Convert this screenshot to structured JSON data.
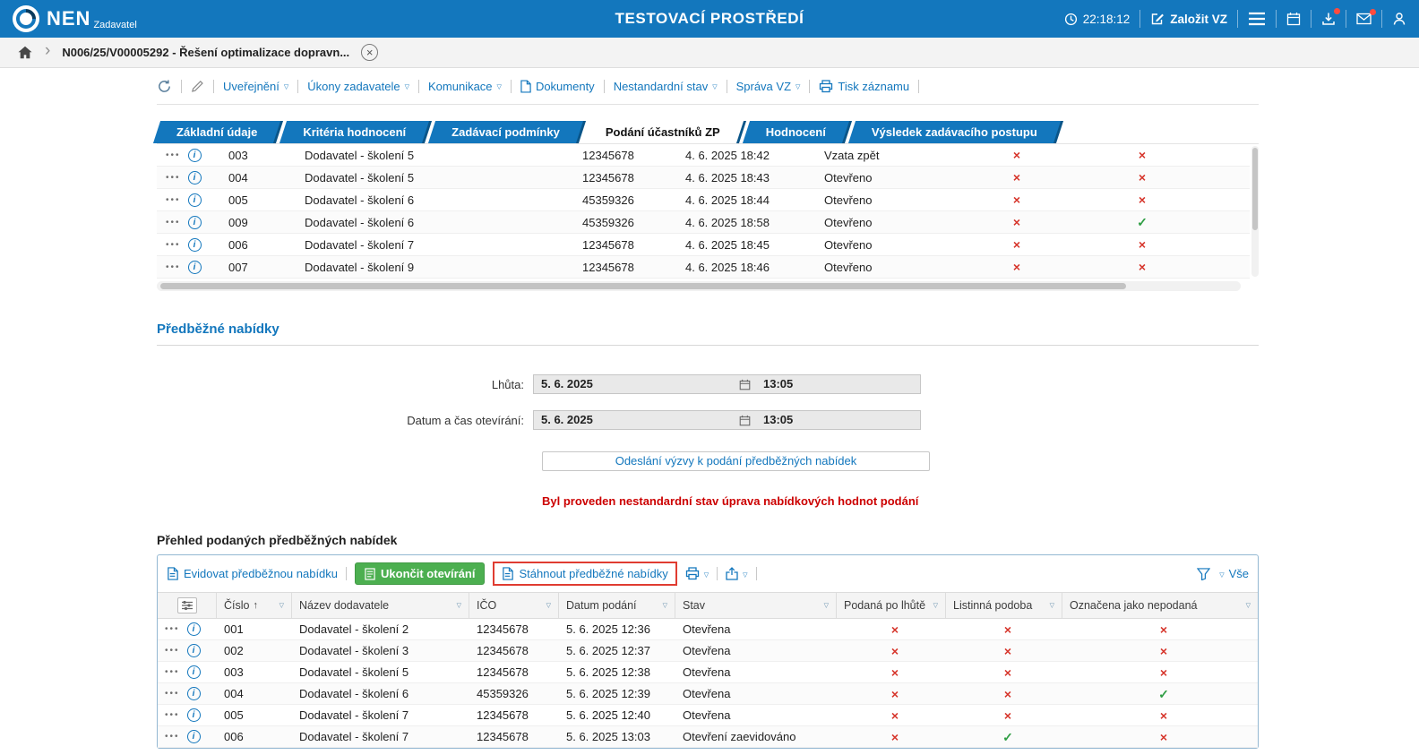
{
  "colors": {
    "topbar_blue": "#1377bd",
    "accent_blue": "#1377bd",
    "green_button": "#4caf50",
    "warning_red": "#cc0000",
    "mark_red": "#d6342a",
    "mark_green": "#2f9e44",
    "highlight_red": "#e03c31"
  },
  "icons": {
    "caret": "▽",
    "sort_asc": "↑",
    "dots_menu": "•••",
    "chevron": "›",
    "info": "i",
    "close": "×",
    "check": "✓",
    "cross": "×"
  },
  "topbar": {
    "brand": "NEN",
    "brand_sub": "Zadavatel",
    "env_title": "TESTOVACÍ PROSTŘEDÍ",
    "time": "22:18:12",
    "create_vz": "Založit VZ"
  },
  "breadcrumb": {
    "record": "N006/25/V00005292 - Řešení optimalizace dopravn..."
  },
  "toolbar": {
    "items": [
      {
        "label": "Uveřejnění"
      },
      {
        "label": "Úkony zadavatele"
      },
      {
        "label": "Komunikace"
      },
      {
        "label": "Dokumenty"
      },
      {
        "label": "Nestandardní stav"
      },
      {
        "label": "Správa VZ"
      },
      {
        "label": "Tisk záznamu"
      }
    ]
  },
  "tabs": [
    {
      "label": "Základní údaje",
      "active": false
    },
    {
      "label": "Kritéria hodnocení",
      "active": false
    },
    {
      "label": "Zadávací podmínky",
      "active": false
    },
    {
      "label": "Podání účastníků ZP",
      "active": true
    },
    {
      "label": "Hodnocení",
      "active": false
    },
    {
      "label": "Výsledek zadávacího postupu",
      "active": false
    }
  ],
  "participants_table": {
    "rows": [
      {
        "cislo": "003",
        "nazev": "Dodavatel - školení 5",
        "ico": "12345678",
        "datum": "4. 6. 2025 18:42",
        "stav": "Vzata zpět",
        "f1": false,
        "f2": false
      },
      {
        "cislo": "004",
        "nazev": "Dodavatel - školení 5",
        "ico": "12345678",
        "datum": "4. 6. 2025 18:43",
        "stav": "Otevřeno",
        "f1": false,
        "f2": false
      },
      {
        "cislo": "005",
        "nazev": "Dodavatel - školení 6",
        "ico": "45359326",
        "datum": "4. 6. 2025 18:44",
        "stav": "Otevřeno",
        "f1": false,
        "f2": false
      },
      {
        "cislo": "009",
        "nazev": "Dodavatel - školení 6",
        "ico": "45359326",
        "datum": "4. 6. 2025 18:58",
        "stav": "Otevřeno",
        "f1": false,
        "f2": true
      },
      {
        "cislo": "006",
        "nazev": "Dodavatel - školení 7",
        "ico": "12345678",
        "datum": "4. 6. 2025 18:45",
        "stav": "Otevřeno",
        "f1": false,
        "f2": false
      },
      {
        "cislo": "007",
        "nazev": "Dodavatel - školení 9",
        "ico": "12345678",
        "datum": "4. 6. 2025 18:46",
        "stav": "Otevřeno",
        "f1": false,
        "f2": false
      }
    ]
  },
  "section": {
    "title": "Předběžné nabídky",
    "lhuta_label": "Lhůta:",
    "lhuta_date": "5. 6. 2025",
    "lhuta_time": "13:05",
    "oteviranie_label": "Datum a čas otevírání:",
    "oteviranie_date": "5. 6. 2025",
    "oteviranie_time": "13:05",
    "send_button": "Odeslání výzvy k podání předběžných nabídek",
    "warning": "Byl proveden nestandardní stav úprava nabídkových hodnot podání",
    "overview_title": "Přehled podaných předběžných nabídek"
  },
  "offers_panel": {
    "toolbar": {
      "evidovat": "Evidovat předběžnou nabídku",
      "ukoncit": "Ukončit otevírání",
      "stahnout": "Stáhnout předběžné nabídky",
      "vse": "Vše"
    },
    "headers": [
      "Číslo",
      "Název dodavatele",
      "IČO",
      "Datum podání",
      "Stav",
      "Podaná po lhůtě",
      "Listinná podoba",
      "Označena jako nepodaná"
    ],
    "rows": [
      {
        "cislo": "001",
        "nazev": "Dodavatel - školení 2",
        "ico": "12345678",
        "datum": "5. 6. 2025 12:36",
        "stav": "Otevřena",
        "po_lhute": false,
        "listinna": false,
        "nepodana": false
      },
      {
        "cislo": "002",
        "nazev": "Dodavatel - školení 3",
        "ico": "12345678",
        "datum": "5. 6. 2025 12:37",
        "stav": "Otevřena",
        "po_lhute": false,
        "listinna": false,
        "nepodana": false
      },
      {
        "cislo": "003",
        "nazev": "Dodavatel - školení 5",
        "ico": "12345678",
        "datum": "5. 6. 2025 12:38",
        "stav": "Otevřena",
        "po_lhute": false,
        "listinna": false,
        "nepodana": false
      },
      {
        "cislo": "004",
        "nazev": "Dodavatel - školení 6",
        "ico": "45359326",
        "datum": "5. 6. 2025 12:39",
        "stav": "Otevřena",
        "po_lhute": false,
        "listinna": false,
        "nepodana": true
      },
      {
        "cislo": "005",
        "nazev": "Dodavatel - školení 7",
        "ico": "12345678",
        "datum": "5. 6. 2025 12:40",
        "stav": "Otevřena",
        "po_lhute": false,
        "listinna": false,
        "nepodana": false
      },
      {
        "cislo": "006",
        "nazev": "Dodavatel - školení 7",
        "ico": "12345678",
        "datum": "5. 6. 2025 13:03",
        "stav": "Otevření zaevidováno",
        "po_lhute": false,
        "listinna": true,
        "nepodana": false
      }
    ]
  }
}
